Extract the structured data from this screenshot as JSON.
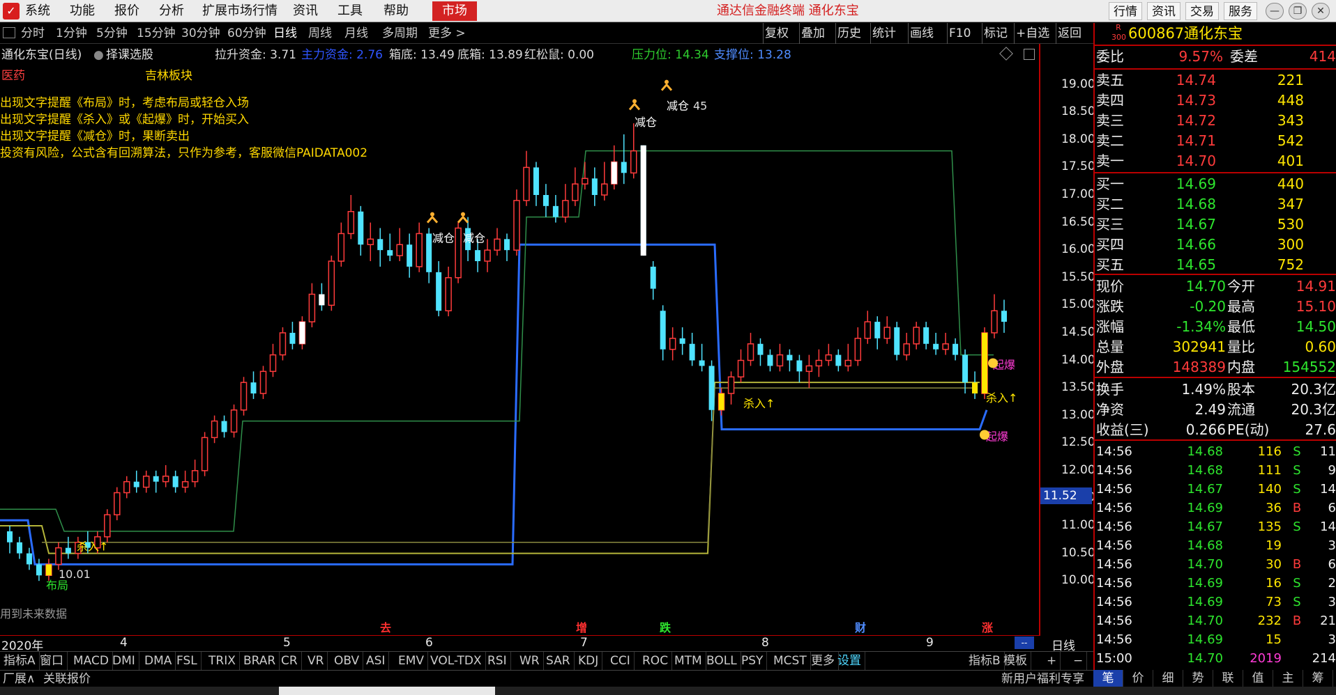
{
  "menubar": {
    "items": [
      "系统",
      "功能",
      "报价",
      "分析",
      "扩展市场行情",
      "资讯",
      "工具",
      "帮助"
    ],
    "active": "市场",
    "title": "通达信金融终端 通化东宝",
    "right_buttons": [
      "行情",
      "资讯",
      "交易",
      "服务"
    ]
  },
  "periodbar": {
    "periods": [
      "分时",
      "1分钟",
      "5分钟",
      "15分钟",
      "30分钟",
      "60分钟",
      "日线",
      "周线",
      "月线",
      "多周期",
      "更多 >"
    ],
    "active": "日线",
    "tools": [
      "复权",
      "叠加",
      "历史",
      "统计",
      "画线",
      "F10",
      "标记",
      "+自选",
      "返回"
    ]
  },
  "chart_header": {
    "stock_title": "通化东宝(日线)",
    "indicator_name": "择课选股",
    "sector": "医药",
    "sector_name": "吉林板块",
    "stats": [
      {
        "label": "拉升资金: 3.71",
        "color": "#d8d8d8"
      },
      {
        "label": "主力资金: 2.76",
        "color": "#2f55ff"
      },
      {
        "label": "箱底: 13.49",
        "color": "#d8d8d8"
      },
      {
        "label": "底箱: 13.89",
        "color": "#d8d8d8"
      },
      {
        "label": "红松鼠: 0.00",
        "color": "#d8d8d8"
      },
      {
        "label": "压力位: 14.34",
        "color": "#2ecc2e"
      },
      {
        "label": "支撑位: 13.28",
        "color": "#4f8cff"
      }
    ],
    "notes": [
      "出现文字提醒《布局》时，考虑布局或轻仓入场",
      "出现文字提醒《杀入》或《起爆》时，开始买入",
      "出现文字提醒《减仓》时，果断卖出",
      "投资有风险，公式含有回溯算法，只作为参考，客服微信PAIDATA002"
    ],
    "future_data_note": "用到未来数据"
  },
  "chart_data": {
    "type": "candlestick",
    "price_axis": {
      "min": 10.0,
      "max": 19.0,
      "ticks": [
        "19.00",
        "18.50",
        "18.00",
        "17.50",
        "17.00",
        "16.50",
        "16.00",
        "15.50",
        "15.00",
        "14.50",
        "14.00",
        "13.50",
        "13.00",
        "12.50",
        "12.00",
        "11.50",
        "11.00",
        "10.50",
        "10.00"
      ]
    },
    "current_price_label": "11.52",
    "x_labels": [
      "2020年",
      "4",
      "5",
      "6",
      "7",
      "8",
      "9"
    ],
    "period_label": "日线",
    "candles": [
      [
        10.9,
        10.7,
        11.0,
        10.5
      ],
      [
        10.7,
        10.5,
        10.8,
        10.4
      ],
      [
        10.5,
        10.3,
        10.6,
        10.2
      ],
      [
        10.3,
        10.1,
        10.4,
        10.0
      ],
      [
        10.1,
        10.3,
        10.4,
        10.0
      ],
      [
        10.3,
        10.6,
        10.7,
        10.2
      ],
      [
        10.6,
        10.5,
        10.8,
        10.4
      ],
      [
        10.5,
        10.7,
        10.8,
        10.4
      ],
      [
        10.7,
        10.6,
        10.9,
        10.5
      ],
      [
        10.6,
        10.8,
        10.9,
        10.5
      ],
      [
        10.8,
        11.2,
        11.3,
        10.7
      ],
      [
        11.2,
        11.6,
        11.7,
        11.1
      ],
      [
        11.6,
        11.8,
        11.9,
        11.5
      ],
      [
        11.8,
        11.7,
        12.0,
        11.6
      ],
      [
        11.7,
        11.9,
        12.0,
        11.6
      ],
      [
        11.9,
        11.8,
        12.0,
        11.6
      ],
      [
        11.8,
        11.9,
        12.1,
        11.7
      ],
      [
        11.9,
        11.7,
        12.0,
        11.6
      ],
      [
        11.7,
        11.8,
        12.0,
        11.6
      ],
      [
        11.8,
        12.0,
        12.2,
        11.7
      ],
      [
        12.0,
        12.6,
        12.7,
        11.9
      ],
      [
        12.6,
        12.9,
        13.0,
        12.5
      ],
      [
        12.9,
        12.7,
        13.0,
        12.6
      ],
      [
        12.7,
        13.1,
        13.2,
        12.6
      ],
      [
        13.1,
        13.6,
        13.7,
        13.0
      ],
      [
        13.6,
        13.4,
        13.8,
        13.3
      ],
      [
        13.4,
        13.8,
        13.9,
        13.3
      ],
      [
        13.8,
        14.1,
        14.3,
        13.7
      ],
      [
        14.1,
        14.5,
        14.6,
        14.0
      ],
      [
        14.5,
        14.3,
        14.7,
        14.2
      ],
      [
        14.3,
        14.7,
        14.8,
        14.2
      ],
      [
        14.7,
        15.2,
        15.4,
        14.6
      ],
      [
        15.2,
        15.0,
        15.4,
        14.9
      ],
      [
        15.0,
        15.8,
        15.9,
        14.9
      ],
      [
        15.8,
        16.3,
        16.5,
        15.7
      ],
      [
        16.3,
        16.7,
        17.0,
        16.2
      ],
      [
        16.7,
        16.1,
        16.8,
        15.9
      ],
      [
        16.1,
        16.2,
        16.5,
        15.8
      ],
      [
        16.2,
        16.0,
        16.4,
        15.7
      ],
      [
        16.0,
        15.9,
        16.3,
        15.8
      ],
      [
        15.9,
        16.1,
        16.4,
        15.8
      ],
      [
        16.1,
        15.7,
        16.3,
        15.5
      ],
      [
        15.7,
        16.3,
        16.5,
        15.6
      ],
      [
        16.3,
        15.6,
        16.4,
        15.4
      ],
      [
        15.6,
        14.9,
        15.8,
        14.8
      ],
      [
        14.9,
        15.5,
        15.7,
        14.8
      ],
      [
        15.5,
        16.4,
        16.5,
        15.4
      ],
      [
        16.4,
        16.0,
        16.6,
        15.8
      ],
      [
        16.0,
        15.8,
        16.2,
        15.6
      ],
      [
        15.8,
        16.0,
        16.2,
        15.6
      ],
      [
        16.0,
        16.2,
        16.4,
        15.9
      ],
      [
        16.2,
        16.0,
        16.3,
        15.8
      ],
      [
        16.0,
        16.9,
        17.1,
        15.9
      ],
      [
        16.9,
        17.5,
        17.8,
        16.8
      ],
      [
        17.5,
        17.0,
        17.6,
        16.8
      ],
      [
        17.0,
        16.8,
        17.2,
        16.6
      ],
      [
        16.8,
        16.6,
        17.0,
        16.5
      ],
      [
        16.6,
        16.9,
        17.2,
        16.5
      ],
      [
        16.9,
        17.2,
        17.5,
        16.8
      ],
      [
        17.2,
        17.3,
        17.6,
        17.1
      ],
      [
        17.3,
        17.0,
        17.5,
        16.8
      ],
      [
        17.0,
        17.2,
        17.6,
        16.9
      ],
      [
        17.2,
        17.6,
        17.9,
        17.1
      ],
      [
        17.6,
        17.4,
        18.1,
        17.2
      ],
      [
        17.4,
        17.8,
        18.3,
        17.3
      ],
      [
        17.9,
        16.0,
        17.9,
        15.9
      ],
      [
        15.7,
        15.3,
        15.8,
        15.1
      ],
      [
        14.9,
        14.2,
        15.0,
        14.0
      ],
      [
        14.2,
        14.4,
        14.6,
        14.0
      ],
      [
        14.4,
        14.3,
        14.6,
        14.1
      ],
      [
        14.3,
        14.0,
        14.5,
        13.9
      ],
      [
        14.0,
        13.9,
        14.3,
        13.8
      ],
      [
        13.9,
        13.1,
        14.0,
        12.9
      ],
      [
        13.1,
        13.4,
        13.5,
        13.0
      ],
      [
        13.4,
        13.7,
        13.8,
        13.2
      ],
      [
        13.7,
        14.0,
        14.2,
        13.6
      ],
      [
        14.0,
        14.3,
        14.5,
        13.9
      ],
      [
        14.3,
        14.1,
        14.4,
        13.9
      ],
      [
        14.1,
        13.9,
        14.2,
        13.8
      ],
      [
        13.9,
        14.1,
        14.3,
        13.8
      ],
      [
        14.1,
        14.0,
        14.2,
        13.8
      ],
      [
        14.0,
        13.8,
        14.1,
        13.6
      ],
      [
        13.8,
        13.9,
        14.1,
        13.5
      ],
      [
        13.9,
        14.0,
        14.2,
        13.7
      ],
      [
        14.0,
        14.1,
        14.3,
        13.9
      ],
      [
        14.1,
        13.9,
        14.2,
        13.8
      ],
      [
        13.9,
        14.0,
        14.3,
        13.8
      ],
      [
        14.0,
        14.4,
        14.6,
        13.9
      ],
      [
        14.4,
        14.7,
        14.9,
        14.3
      ],
      [
        14.7,
        14.4,
        14.8,
        14.2
      ],
      [
        14.4,
        14.6,
        14.8,
        14.3
      ],
      [
        14.6,
        14.1,
        14.7,
        14.0
      ],
      [
        14.1,
        14.3,
        14.5,
        14.0
      ],
      [
        14.3,
        14.6,
        14.7,
        14.2
      ],
      [
        14.6,
        14.3,
        14.7,
        14.2
      ],
      [
        14.3,
        14.2,
        14.5,
        14.1
      ],
      [
        14.2,
        14.3,
        14.5,
        14.1
      ],
      [
        14.3,
        14.1,
        14.4,
        14.0
      ],
      [
        14.1,
        13.6,
        14.2,
        13.4
      ],
      [
        13.6,
        13.4,
        13.8,
        13.3
      ],
      [
        13.4,
        14.5,
        14.6,
        13.3
      ],
      [
        14.5,
        14.9,
        15.2,
        14.4
      ],
      [
        14.9,
        14.7,
        15.1,
        14.5
      ]
    ],
    "labels": {
      "布局": "布局",
      "low_price": "10.01",
      "杀入": "杀入↑",
      "减仓": "减仓",
      "起爆": "起爆",
      "high_price": "45"
    },
    "events": [
      {
        "text": "去",
        "color": "#ff3030"
      },
      {
        "text": "增",
        "color": "#ff3030"
      },
      {
        "text": "跌",
        "color": "#2ee62e"
      },
      {
        "text": "财",
        "color": "#4f8cff"
      },
      {
        "text": "涨",
        "color": "#ff3030"
      }
    ]
  },
  "indicator_tabs": [
    "指标A",
    "窗口",
    "MACD",
    "DMI",
    "DMA",
    "FSL",
    "TRIX",
    "BRAR",
    "CR",
    "VR",
    "OBV",
    "ASI",
    "EMV",
    "VOL-TDX",
    "RSI",
    "WR",
    "SAR",
    "KDJ",
    "CCI",
    "ROC",
    "MTM",
    "BOLL",
    "PSY",
    "MCST",
    "更多",
    "设置"
  ],
  "indicator_right": [
    "指标B",
    "模板",
    "+",
    "−"
  ],
  "bottom": {
    "expand": "厂展∧",
    "quote": "关联报价",
    "promo": "新用户福利专享"
  },
  "right_panel": {
    "code": "600867",
    "name": "通化东宝",
    "market_tag": "R 300",
    "weibi_label": "委比",
    "weibi": "9.57%",
    "weicha_label": "委差",
    "weicha": "414",
    "asks": [
      {
        "label": "卖五",
        "price": "14.74",
        "vol": "221"
      },
      {
        "label": "卖四",
        "price": "14.73",
        "vol": "448"
      },
      {
        "label": "卖三",
        "price": "14.72",
        "vol": "343"
      },
      {
        "label": "卖二",
        "price": "14.71",
        "vol": "542"
      },
      {
        "label": "卖一",
        "price": "14.70",
        "vol": "401"
      }
    ],
    "bids": [
      {
        "label": "买一",
        "price": "14.69",
        "vol": "440"
      },
      {
        "label": "买二",
        "price": "14.68",
        "vol": "347"
      },
      {
        "label": "买三",
        "price": "14.67",
        "vol": "530"
      },
      {
        "label": "买四",
        "price": "14.66",
        "vol": "300"
      },
      {
        "label": "买五",
        "price": "14.65",
        "vol": "752"
      }
    ],
    "stats": [
      {
        "l1": "现价",
        "v1": "14.70",
        "c1": "green",
        "l2": "今开",
        "v2": "14.91",
        "c2": "red"
      },
      {
        "l1": "涨跌",
        "v1": "-0.20",
        "c1": "green",
        "l2": "最高",
        "v2": "15.10",
        "c2": "red"
      },
      {
        "l1": "涨幅",
        "v1": "-1.34%",
        "c1": "green",
        "l2": "最低",
        "v2": "14.50",
        "c2": "green"
      },
      {
        "l1": "总量",
        "v1": "302941",
        "c1": "yellow",
        "l2": "量比",
        "v2": "0.60",
        "c2": "yellow"
      },
      {
        "l1": "外盘",
        "v1": "148389",
        "c1": "red",
        "l2": "内盘",
        "v2": "154552",
        "c2": "green"
      }
    ],
    "stats2": [
      {
        "l1": "换手",
        "v1": "1.49%",
        "l2": "股本",
        "v2": "20.3亿"
      },
      {
        "l1": "净资",
        "v1": "2.49",
        "l2": "流通",
        "v2": "20.3亿"
      },
      {
        "l1": "收益(三)",
        "v1": "0.266",
        "l2": "PE(动)",
        "v2": "27.6"
      }
    ],
    "ticks": [
      {
        "time": "14:56",
        "price": "14.68",
        "vol": "116",
        "side": "S",
        "n": "11"
      },
      {
        "time": "14:56",
        "price": "14.68",
        "vol": "111",
        "side": "S",
        "n": "9"
      },
      {
        "time": "14:56",
        "price": "14.67",
        "vol": "140",
        "side": "S",
        "n": "14"
      },
      {
        "time": "14:56",
        "price": "14.69",
        "vol": "36",
        "side": "B",
        "n": "6"
      },
      {
        "time": "14:56",
        "price": "14.67",
        "vol": "135",
        "side": "S",
        "n": "14"
      },
      {
        "time": "14:56",
        "price": "14.68",
        "vol": "19",
        "side": "",
        "n": "3"
      },
      {
        "time": "14:56",
        "price": "14.70",
        "vol": "30",
        "side": "B",
        "n": "6"
      },
      {
        "time": "14:56",
        "price": "14.69",
        "vol": "16",
        "side": "S",
        "n": "2"
      },
      {
        "time": "14:56",
        "price": "14.69",
        "vol": "73",
        "side": "S",
        "n": "3"
      },
      {
        "time": "14:56",
        "price": "14.70",
        "vol": "232",
        "side": "B",
        "n": "21"
      },
      {
        "time": "14:56",
        "price": "14.69",
        "vol": "15",
        "side": "",
        "n": "3"
      },
      {
        "time": "15:00",
        "price": "14.70",
        "vol": "2019",
        "side": "",
        "n": "214"
      }
    ],
    "bottom_tabs": [
      "笔",
      "价",
      "细",
      "势",
      "联",
      "值",
      "主",
      "筹"
    ]
  }
}
